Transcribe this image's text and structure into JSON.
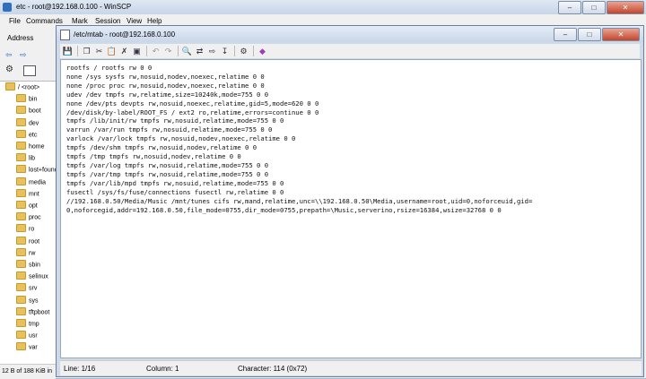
{
  "main_window": {
    "title": "etc - root@192.168.0.100 - WinSCP",
    "menu": [
      "File",
      "Commands",
      "Mark",
      "Session",
      "View",
      "Help"
    ],
    "address_label": "Address",
    "status_text": "12 B of 188 KiB in"
  },
  "tree": {
    "items": [
      "/ <root>",
      "bin",
      "boot",
      "dev",
      "etc",
      "home",
      "lib",
      "lost+found",
      "media",
      "mnt",
      "opt",
      "proc",
      "ro",
      "root",
      "rw",
      "sbin",
      "selinux",
      "srv",
      "sys",
      "tftpboot",
      "tmp",
      "usr",
      "var"
    ]
  },
  "editor": {
    "title": "/etc/mtab - root@192.168.0.100",
    "icons": [
      "save-icon",
      "copy-icon",
      "cut-icon",
      "paste-icon",
      "delete-icon",
      "select-all-icon",
      "undo-icon",
      "redo-icon",
      "find-icon",
      "replace-icon",
      "find-next-icon",
      "go-to-line-icon",
      "settings-icon",
      "close-editor-icon"
    ],
    "lines": [
      "rootfs / rootfs rw 0 0",
      "none /sys sysfs rw,nosuid,nodev,noexec,relatime 0 0",
      "none /proc proc rw,nosuid,nodev,noexec,relatime 0 0",
      "udev /dev tmpfs rw,relatime,size=10240k,mode=755 0 0",
      "none /dev/pts devpts rw,nosuid,noexec,relatime,gid=5,mode=620 0 0",
      "/dev/disk/by-label/ROOT_FS / ext2 ro,relatime,errors=continue 0 0",
      "tmpfs /lib/init/rw tmpfs rw,nosuid,relatime,mode=755 0 0",
      "varrun /var/run tmpfs rw,nosuid,relatime,mode=755 0 0",
      "varlock /var/lock tmpfs rw,nosuid,nodev,noexec,relatime 0 0",
      "tmpfs /dev/shm tmpfs rw,nosuid,nodev,relatime 0 0",
      "tmpfs /tmp tmpfs rw,nosuid,nodev,relatime 0 0",
      "tmpfs /var/log tmpfs rw,nosuid,relatime,mode=755 0 0",
      "tmpfs /var/tmp tmpfs rw,nosuid,relatime,mode=755 0 0",
      "tmpfs /var/lib/mpd tmpfs rw,nosuid,relatime,mode=755 0 0",
      "fusectl /sys/fs/fuse/connections fusectl rw,relatime 0 0",
      "//192.168.0.50/Media/Music /mnt/tunes cifs rw,mand,relatime,unc=\\\\192.168.0.50\\Media,username=root,uid=0,noforceuid,gid=",
      "0,noforcegid,addr=192.168.0.50,file_mode=0755,dir_mode=0755,prepath=\\Music,serverino,rsize=16384,wsize=32768 0 0"
    ],
    "status": {
      "line": "Line: 1/16",
      "column": "Column: 1",
      "character": "Character: 114 (0x72)"
    }
  }
}
